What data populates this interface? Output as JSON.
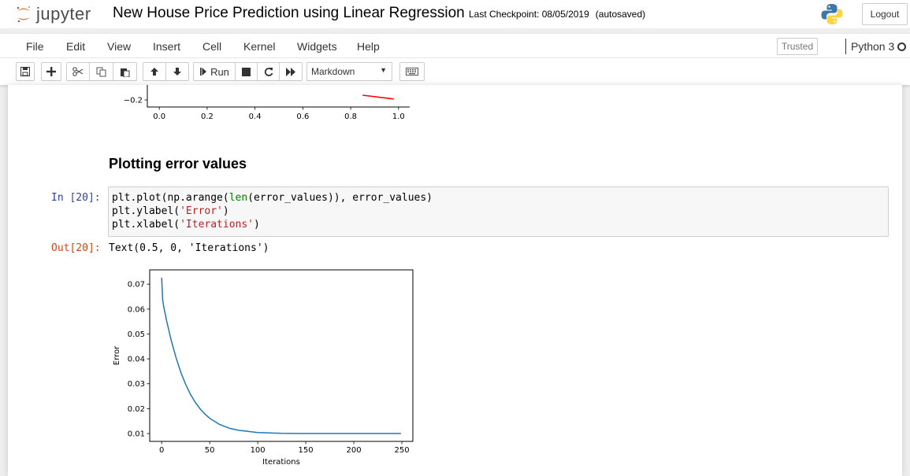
{
  "header": {
    "logo_text": "jupyter",
    "notebook_title": "New House Price Prediction using Linear Regression",
    "checkpoint": "Last Checkpoint: 08/05/2019",
    "autosave_status": "(autosaved)",
    "logout_label": "Logout"
  },
  "menubar": {
    "items": [
      "File",
      "Edit",
      "View",
      "Insert",
      "Cell",
      "Kernel",
      "Widgets",
      "Help"
    ],
    "trusted_label": "Trusted",
    "kernel_name": "Python 3"
  },
  "toolbar": {
    "run_label": "Run",
    "cell_type": "Markdown",
    "icons": [
      "save-icon",
      "plus-icon",
      "cut-icon",
      "copy-icon",
      "paste-icon",
      "arrow-up-icon",
      "arrow-down-icon",
      "step-forward-icon",
      "stop-icon",
      "restart-icon",
      "fast-forward-icon",
      "keyboard-icon"
    ]
  },
  "notebook": {
    "markdown_heading": "Plotting error values",
    "input_prompt": "In [20]:",
    "code_lines": [
      [
        {
          "t": "plt.plot(np.arange("
        },
        {
          "t": "len",
          "c": "kw-builtin"
        },
        {
          "t": "(error_values)), error_values)"
        }
      ],
      [
        {
          "t": "plt.ylabel("
        },
        {
          "t": "'Error'",
          "c": "str"
        },
        {
          "t": ")"
        }
      ],
      [
        {
          "t": "plt.xlabel("
        },
        {
          "t": "'Iterations'",
          "c": "str"
        },
        {
          "t": ")"
        }
      ]
    ],
    "output_prompt": "Out[20]:",
    "output_text": "Text(0.5, 0, 'Iterations')"
  },
  "chart_data": [
    {
      "type": "line",
      "note_visible": "partially scrolled out of view",
      "x_ticks": [
        "0.0",
        "0.2",
        "0.4",
        "0.6",
        "0.8",
        "1.0"
      ],
      "y_ticks_visible": [
        "−0.2"
      ],
      "series": [
        {
          "color": "#ff0000",
          "x": [
            0.85,
            0.98
          ],
          "y": [
            -0.1,
            -0.18
          ]
        }
      ],
      "xlim": [
        -0.05,
        1.05
      ],
      "ylim": [
        -0.23,
        0.9
      ]
    },
    {
      "type": "line",
      "title": "",
      "xlabel": "Iterations",
      "ylabel": "Error",
      "xlim": [
        -12.45,
        261.45
      ],
      "ylim": [
        0.00685,
        0.07574
      ],
      "x_ticks": [
        0,
        50,
        100,
        150,
        200,
        250
      ],
      "y_ticks": [
        0.01,
        0.02,
        0.03,
        0.04,
        0.05,
        0.06,
        0.07
      ],
      "series": [
        {
          "color": "#1f77b4",
          "x": [
            0,
            1,
            2,
            5,
            10,
            15,
            20,
            25,
            30,
            35,
            40,
            45,
            50,
            60,
            70,
            80,
            100,
            125,
            150,
            200,
            249
          ],
          "y": [
            0.0726,
            0.0639,
            0.0613,
            0.0555,
            0.0473,
            0.0404,
            0.0345,
            0.0297,
            0.0257,
            0.0225,
            0.0199,
            0.0178,
            0.0161,
            0.0137,
            0.0122,
            0.0113,
            0.0104,
            0.01008,
            0.01,
            0.01,
            0.01
          ]
        }
      ]
    }
  ]
}
